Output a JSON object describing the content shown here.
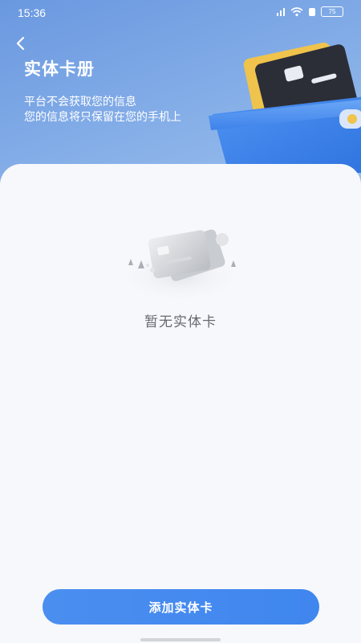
{
  "status_bar": {
    "time": "15:36",
    "battery": "75",
    "icons": [
      "network-icon",
      "wifi-icon",
      "notification-icon",
      "battery-icon"
    ]
  },
  "header": {
    "back_icon": "chevron-left-icon",
    "title": "实体卡册",
    "subtitle_line1": "平台不会获取您的信息",
    "subtitle_line2": "您的信息将只保留在您的手机上"
  },
  "empty_state": {
    "illustration": "empty-cards-illustration",
    "message": "暂无实体卡"
  },
  "actions": {
    "add_label": "添加实体卡"
  },
  "colors": {
    "header_gradient_start": "#6a98e0",
    "header_gradient_end": "#c9def7",
    "card_background": "#f7f8fb",
    "primary_button": "#4b8ef0",
    "empty_text": "#666a70"
  }
}
